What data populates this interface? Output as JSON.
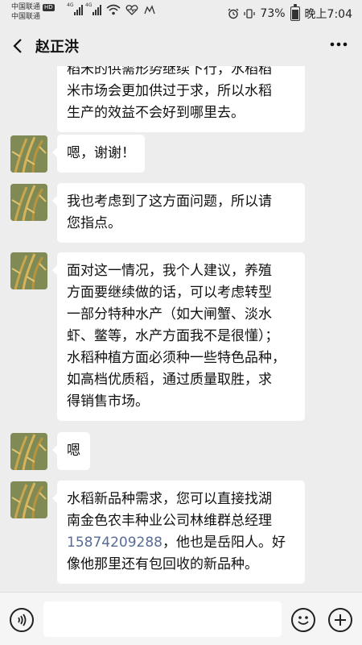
{
  "status_bar": {
    "carrier1": "中国联通",
    "hd": "HD",
    "carrier2": "中国联通",
    "sig1": "4G",
    "sig2": "4G",
    "battery": "73%",
    "time": "晚上7:04",
    "battery_level": 0.73
  },
  "header": {
    "title": "赵正洪"
  },
  "messages": [
    {
      "lines": [
        "稻米的供需形势继续下行，水稻稻",
        "米市场会更加供过于求，所以水稻",
        "生产的效益不会好到哪里去。"
      ]
    },
    {
      "lines": [
        "嗯，谢谢！"
      ]
    },
    {
      "lines": [
        "我也考虑到了这方面问题，所以请",
        "您指点。"
      ]
    },
    {
      "lines": [
        "面对这一情况，我个人建议，养殖",
        "方面要继续做的话，可以考虑转型",
        "一部分特种水产（如大闸蟹、淡水",
        "虾、鳖等，水产方面我不是很懂）；",
        "水稻种植方面必须种一些特色品种，",
        "如高档优质稻，通过质量取胜，求",
        "得销售市场。"
      ]
    },
    {
      "lines": [
        "嗯"
      ]
    },
    {
      "line1": "水稻新品种需求，您可以直接找湖",
      "line2": "南金色农丰种业公司林维群总经理",
      "phone": "15874209288",
      "line3_rest": "，他也是岳阳人。好",
      "line4": "像他那里还有包回收的新品种。"
    }
  ]
}
